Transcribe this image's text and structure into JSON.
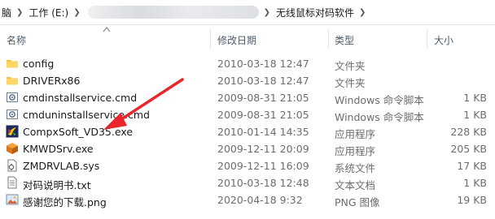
{
  "breadcrumb": {
    "items": [
      "脑",
      "工作 (E:)",
      "无线鼠标对码软件"
    ],
    "blurred_segment": true
  },
  "columns": {
    "name": "名称",
    "date": "修改日期",
    "type": "类型",
    "size": "大小"
  },
  "files": [
    {
      "icon": "folder-icon",
      "name": "config",
      "date": "2010-03-18 12:47",
      "type": "文件夹",
      "size": ""
    },
    {
      "icon": "folder-icon",
      "name": "DRIVERx86",
      "date": "2010-03-18 12:47",
      "type": "文件夹",
      "size": ""
    },
    {
      "icon": "cmd-file-icon",
      "name": "cmdinstallservice.cmd",
      "date": "2009-08-31 21:05",
      "type": "Windows 命令脚本",
      "size": "1 KB"
    },
    {
      "icon": "cmd-file-icon",
      "name": "cmduninstallservice.cmd",
      "date": "2009-08-31 21:05",
      "type": "Windows 命令脚本",
      "size": "1 KB"
    },
    {
      "icon": "exe-app-icon",
      "name": "CompxSoft_VD35.exe",
      "date": "2010-01-14 14:35",
      "type": "应用程序",
      "size": "228 KB"
    },
    {
      "icon": "exe-service-icon",
      "name": "KMWDSrv.exe",
      "date": "2009-12-11 20:09",
      "type": "应用程序",
      "size": "205 KB"
    },
    {
      "icon": "sys-file-icon",
      "name": "ZMDRVLAB.sys",
      "date": "2009-12-11 16:09",
      "type": "系统文件",
      "size": "17 KB"
    },
    {
      "icon": "text-file-icon",
      "name": "对码说明书.txt",
      "date": "2010-03-18 12:48",
      "type": "文本文档",
      "size": "1 KB"
    },
    {
      "icon": "png-image-icon",
      "name": "感谢您的下载.png",
      "date": "2020-04-18 9:32",
      "type": "PNG 图像",
      "size": "19 KB"
    }
  ],
  "annotation_color": "#e8262b"
}
